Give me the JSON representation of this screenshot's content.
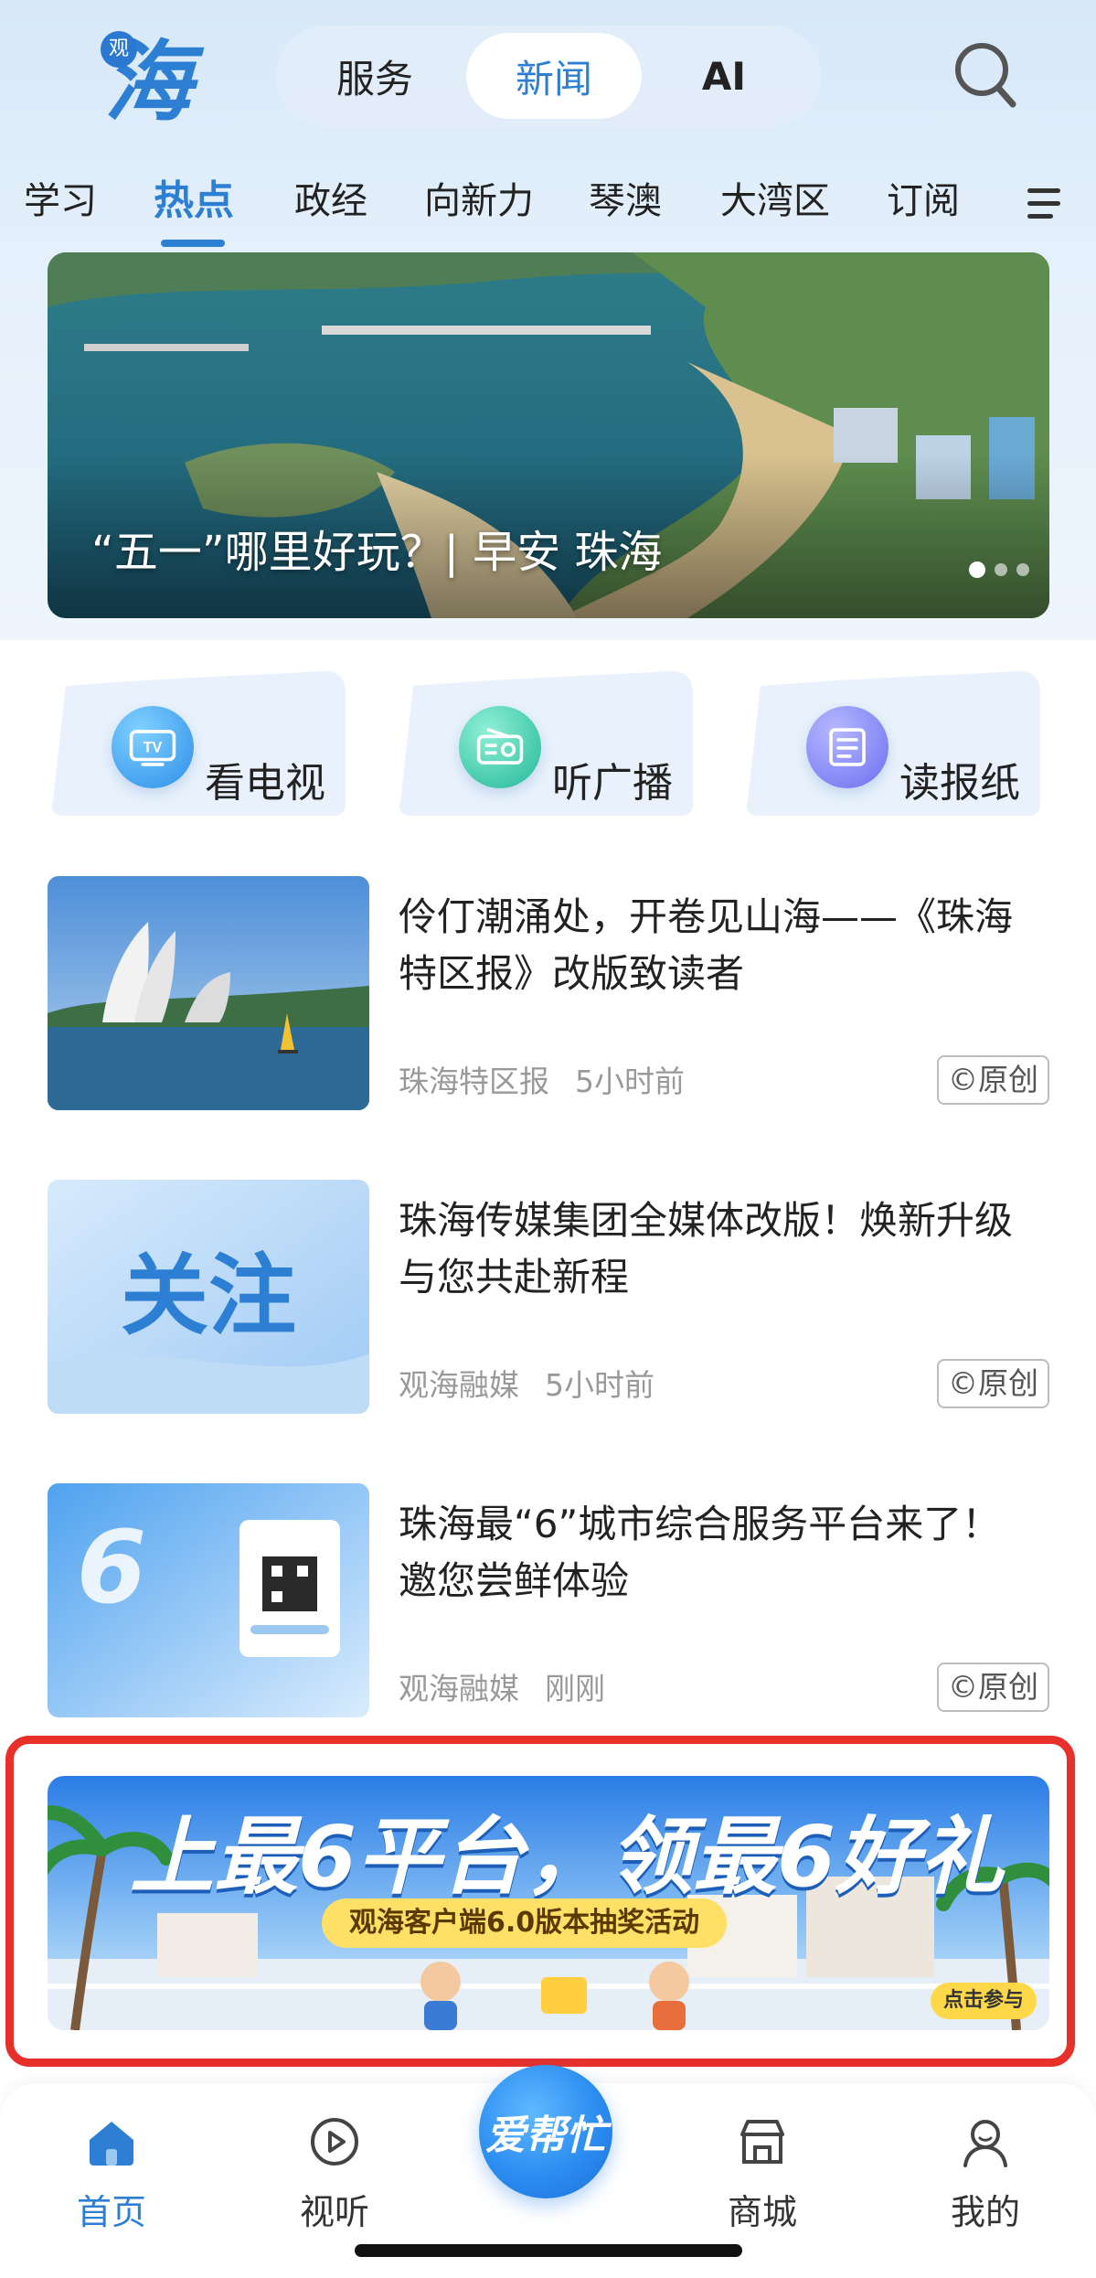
{
  "app": {
    "logo_badge": "观",
    "logo_text": "海"
  },
  "segments": [
    {
      "label": "服务"
    },
    {
      "label": "新闻"
    },
    {
      "label": "AI"
    }
  ],
  "categories": [
    {
      "label": "学习"
    },
    {
      "label": "热点"
    },
    {
      "label": "政经"
    },
    {
      "label": "向新力"
    },
    {
      "label": "琴澳"
    },
    {
      "label": "大湾区"
    },
    {
      "label": "订阅"
    }
  ],
  "banner": {
    "title": "“五一”哪里好玩？| 早安 珠海"
  },
  "entries": [
    {
      "label": "看电视",
      "icon": "tv-icon"
    },
    {
      "label": "听广播",
      "icon": "radio-icon"
    },
    {
      "label": "读报纸",
      "icon": "newspaper-icon"
    }
  ],
  "news": [
    {
      "title": "伶仃潮涌处，开卷见山海——《珠海特区报》改版致读者",
      "source": "珠海特区报",
      "time": "5小时前",
      "badge": "©原创"
    },
    {
      "title": "珠海传媒集团全媒体改版！焕新升级与您共赴新程",
      "source": "观海融媒",
      "time": "5小时前",
      "badge": "©原创",
      "thumb_text": "关注"
    },
    {
      "title": "珠海最“6”城市综合服务平台来了！邀您尝鲜体验",
      "source": "观海融媒",
      "time": "刚刚",
      "badge": "©原创"
    }
  ],
  "promo": {
    "headline": "上最6平台，领最6好礼",
    "subtitle": "观海客户端6.0版本抽奖活动",
    "cta": "点击参与"
  },
  "tabbar": [
    {
      "label": "首页"
    },
    {
      "label": "视听"
    },
    {
      "label": "商城"
    },
    {
      "label": "我的"
    }
  ],
  "center_button": {
    "label": "爱帮忙"
  },
  "colors": {
    "accent": "#2d7fd4",
    "highlight_frame": "#e8302a"
  }
}
